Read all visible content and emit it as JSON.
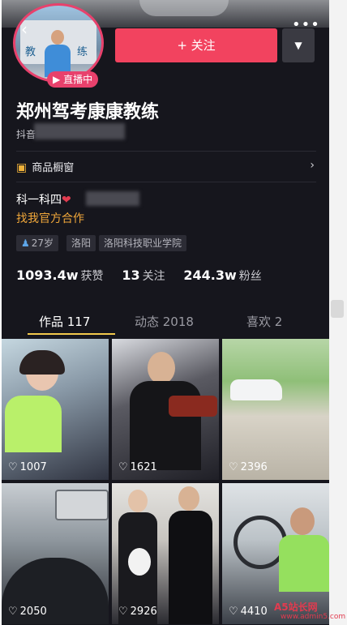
{
  "profile": {
    "name": "郑州驾考康康教练",
    "douyin_id_prefix": "抖音",
    "live_label": "直播中",
    "follow_label": "+ 关注",
    "more_icon": "more-icon",
    "dropdown_icon": "chevron-down-icon",
    "back_icon": "back-arrow-icon",
    "avatar_chars": [
      "教",
      "练"
    ]
  },
  "shop": {
    "label": "商品橱窗",
    "icon": "shop-icon",
    "chevron": "›"
  },
  "bio": {
    "line1": "科一科四",
    "line2": "找我官方合作"
  },
  "tags": [
    {
      "label": "27岁",
      "icon": "person-icon"
    },
    {
      "label": "洛阳"
    },
    {
      "label": "洛阳科技职业学院"
    }
  ],
  "stats": [
    {
      "value": "1093.4w",
      "label": "获赞"
    },
    {
      "value": "13",
      "label": "关注"
    },
    {
      "value": "244.3w",
      "label": "粉丝"
    }
  ],
  "tabs": [
    {
      "label": "作品 117",
      "active": true
    },
    {
      "label": "动态 2018",
      "active": false
    },
    {
      "label": "喜欢 2",
      "active": false
    }
  ],
  "videos": [
    {
      "likes": "1007"
    },
    {
      "likes": "1621"
    },
    {
      "likes": "2396"
    },
    {
      "likes": "2050"
    },
    {
      "likes": "2926"
    },
    {
      "likes": "4410"
    }
  ],
  "watermark": {
    "line1": "A5站长网",
    "line2": "www.admin5.com"
  },
  "colors": {
    "accent": "#f2435f",
    "live": "#e8416c",
    "highlight": "#f0a73a",
    "tab_underline": "#f2c94c",
    "background": "#16161d"
  }
}
